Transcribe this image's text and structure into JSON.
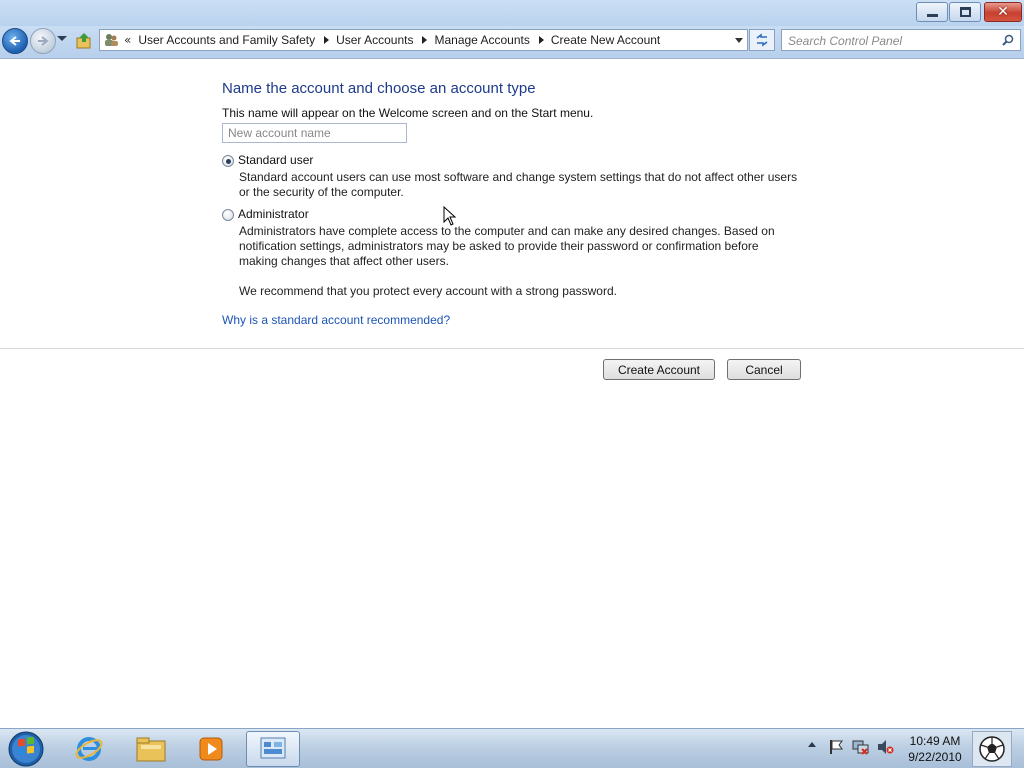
{
  "window": {
    "min_icon": "minimize-icon",
    "max_icon": "restore-icon",
    "close_icon": "close-icon"
  },
  "navbar": {
    "chevron": "«",
    "breadcrumbs": [
      "User Accounts and Family Safety",
      "User Accounts",
      "Manage Accounts",
      "Create New Account"
    ],
    "search_placeholder": "Search Control Panel"
  },
  "content": {
    "heading": "Name the account and choose an account type",
    "subtext": "This name will appear on the Welcome screen and on the Start menu.",
    "name_placeholder": "New account name",
    "options": [
      {
        "label": "Standard user",
        "description": "Standard account users can use most software and change system settings that do not affect other users or the security of the computer.",
        "selected": true
      },
      {
        "label": "Administrator",
        "description": "Administrators have complete access to the computer and can make any desired changes. Based on notification settings, administrators may be asked to provide their password or confirmation before making changes that affect other users.",
        "selected": false
      }
    ],
    "recommend": "We recommend that you protect every account with a strong password.",
    "link": "Why is a standard account recommended?",
    "create_button": "Create Account",
    "cancel_button": "Cancel"
  },
  "taskbar": {
    "time": "10:49 AM",
    "date": "9/22/2010",
    "pinned": [
      "internet-explorer-icon",
      "windows-explorer-icon",
      "media-player-icon",
      "control-panel-icon"
    ]
  },
  "colors": {
    "heading": "#1e3b8a",
    "link": "#1c54b8",
    "titlebar": "#c9ddf3"
  }
}
